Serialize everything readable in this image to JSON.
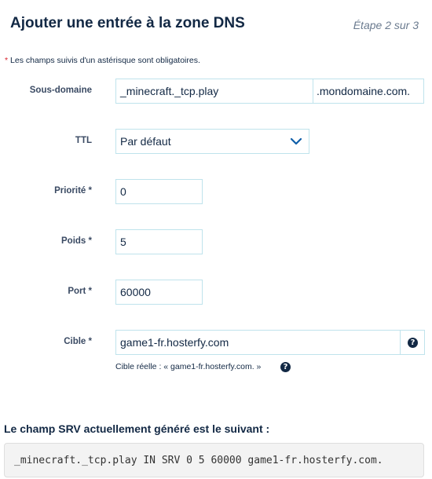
{
  "header": {
    "title": "Ajouter une entrée à la zone DNS",
    "step": "Étape 2 sur 3"
  },
  "required_note": {
    "star": "*",
    "text": " Les champs suivis d'un astérisque sont obligatoires."
  },
  "form": {
    "subdomain": {
      "label": "Sous-domaine",
      "value": "_minecraft._tcp.play",
      "suffix": ".mondomaine.com."
    },
    "ttl": {
      "label": "TTL",
      "value": "Par défaut"
    },
    "priority": {
      "label": "Priorité *",
      "value": "0"
    },
    "weight": {
      "label": "Poids *",
      "value": "5"
    },
    "port": {
      "label": "Port *",
      "value": "60000"
    },
    "target": {
      "label": "Cible *",
      "value": "game1-fr.hosterfy.com",
      "hint": "Cible réelle : « game1-fr.hosterfy.com. »"
    }
  },
  "icons": {
    "help": "question-circle-icon",
    "chevron": "chevron-down-icon"
  },
  "generated": {
    "title": "Le champ SRV actuellement généré est le suivant :",
    "record": "_minecraft._tcp.play IN SRV 0 5 60000 game1-fr.hosterfy.com."
  },
  "colors": {
    "text": "#122844",
    "accent": "#0f5ea8",
    "border": "#bfe3ec",
    "required": "#d9232d"
  }
}
